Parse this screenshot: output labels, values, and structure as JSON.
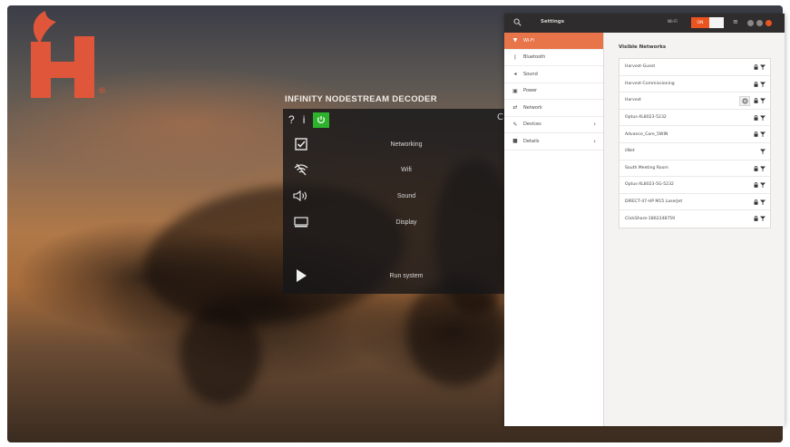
{
  "colors": {
    "brand_orange": "#e0563a",
    "ubuntu_orange": "#e95420",
    "sidebar_active": "#e8744a",
    "decoder_green": "#2eb22e",
    "titlebar": "#2e2c2c"
  },
  "logo": {
    "letter": "H",
    "registered": "®",
    "icon": "leaf-icon"
  },
  "decoder": {
    "title": "INFINITY NODESTREAM DECODER",
    "toolbar": {
      "help": "?",
      "info": "i",
      "active_icon": "power-icon"
    },
    "items": [
      {
        "label": "Networking",
        "icon": "checkbox-icon"
      },
      {
        "label": "Wifi",
        "icon": "wifi-off-icon"
      },
      {
        "label": "Sound",
        "icon": "speaker-icon"
      },
      {
        "label": "Display",
        "icon": "monitor-icon"
      },
      {
        "label": "Run system",
        "icon": "play-icon"
      }
    ]
  },
  "settings": {
    "title": "Settings",
    "header_wifi_label": "Wi-Fi",
    "toggle_label": "ON",
    "sidebar": [
      {
        "label": "Wi-Fi",
        "icon": "wifi-icon",
        "active": true
      },
      {
        "label": "Bluetooth",
        "icon": "bluetooth-icon"
      },
      {
        "label": "Sound",
        "icon": "speaker-icon"
      },
      {
        "label": "Power",
        "icon": "battery-icon"
      },
      {
        "label": "Network",
        "icon": "network-icon"
      },
      {
        "label": "Devices",
        "icon": "devices-icon",
        "chevron": true
      },
      {
        "label": "Details",
        "icon": "details-icon",
        "chevron": true
      }
    ],
    "content_title": "Visible Networks",
    "networks": [
      {
        "name": "Harvest-Guest",
        "locked": true,
        "gear": false
      },
      {
        "name": "Harvest-Commissioning",
        "locked": true,
        "gear": false
      },
      {
        "name": "Harvest",
        "locked": true,
        "gear": true
      },
      {
        "name": "Optus-XL8023-5232",
        "locked": true,
        "gear": false
      },
      {
        "name": "Advance_Care_5WIN",
        "locked": true,
        "gear": false
      },
      {
        "name": "iiNet",
        "locked": false,
        "gear": false
      },
      {
        "name": "South Meeting Room",
        "locked": true,
        "gear": false
      },
      {
        "name": "Optus-XL8023-5G-5232",
        "locked": true,
        "gear": false
      },
      {
        "name": "DIRECT-47-HP M15 LaserJet",
        "locked": true,
        "gear": false
      },
      {
        "name": "ClickShare-1862348759",
        "locked": true,
        "gear": false
      }
    ]
  }
}
